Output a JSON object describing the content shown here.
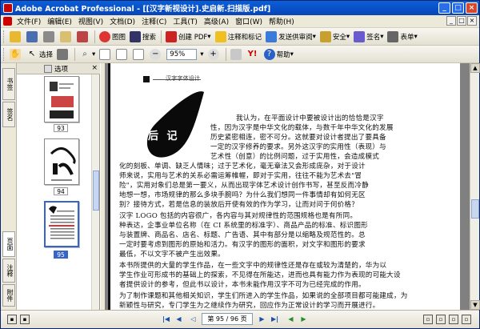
{
  "window": {
    "title": "Adobe Acrobat Professional - [[汉字新视设计].史启新.扫描版.pdf]",
    "min_label": "_",
    "max_label": "□",
    "close_label": "×"
  },
  "menu": {
    "items": [
      "文件(F)",
      "编辑(E)",
      "视图(V)",
      "文档(D)",
      "注释(C)",
      "工具(T)",
      "高级(A)",
      "窗口(W)",
      "帮助(H)"
    ],
    "doc_controls": [
      "_",
      "□",
      "×"
    ]
  },
  "toolbar1": {
    "create_pdf": "创建 PDF",
    "comment": "注释和标记",
    "send_review": "发送供审阅",
    "security": "安全",
    "sign": "签名",
    "forms": "表单",
    "tools_a": "图图",
    "search": "搜索"
  },
  "toolbar2": {
    "select": "选择",
    "zoom": "95%",
    "help": "帮助"
  },
  "panel": {
    "title": "选项",
    "close": "×",
    "tabs": [
      "书签",
      "签名",
      "页面",
      "注释",
      "附件"
    ],
    "page_numbers": [
      "93",
      "94",
      "95"
    ]
  },
  "page": {
    "header": "汉字字体设计",
    "afterword_title": "后 记",
    "paragraphs": [
      "我认为，在平面设计中要被设计出的恰恰是汉字",
      "性，因为汉字是中华文化的载体，与数千年中华文化的发展",
      "历史紧密相连，密不可分。这就要对设计者提出了要具备",
      "一定的汉字修养的要求。另外这汉字的实用性（表现）与",
      "艺术性（创意）的比例问题，过于实用性，会造成模式",
      "化的刻板、单调、缺乏人情味；过于艺术化，毫无章法又会形成庞杂，对于设计",
      "师来说，实用与艺术的关系必需运筹帷幄，即对于实用，往往不能为艺术去\"冒",
      "险\"，实用对象们总是第一要义，从而出现字体艺术设计创作书写，甚至反而冷静",
      "地想一想，市场规律的那么多块手腕吗？为什么我们想同一件事情却有如何无区",
      "别？接待方式，若是信息的装放后开使有效的作为学习，让而对问于何价格？",
      "    汉字 LOGO 包括的内容很广，各内容与其对规律性的范围规格也是有所同。",
      "种表达，企事业单位名称（在 CI 系统里的标准字）、商品产品的标准、标识图形",
      "与装置牌、商品名、店名、标题、广告语、其中有部分是以缩略及规范性的。总",
      "一定时要考虑到图形的原始和活力。有汉字的图形的面积，对文字和图形的要求",
      "最低，不以文字不被产生出效果。",
      "    本书所提供的大量的学生作品，在一些文字中的规律性还是存在或较为清楚的，华为以",
      "学生作业可形成书的基础上的探索，不见得在所能达，进而也具有能力作为表现的可能大设",
      "者提供设计的参考，但此书以设计，本书未能作用汉字不可为已经完成的作用。",
      "    为了制作课题和其他相关知识，学生们所进入的学生作品，如果说的全部项目都可能建成，为",
      "新颖性与研究，专门学生为之继续作为研究，回应作为正常设计的学习而开展进行。"
    ]
  },
  "status": {
    "page_box": "第 95 / 96 页"
  },
  "colors": {
    "title_bar": "#0a5fd8",
    "selected": "#3764c8",
    "doc_bg": "#808080"
  }
}
